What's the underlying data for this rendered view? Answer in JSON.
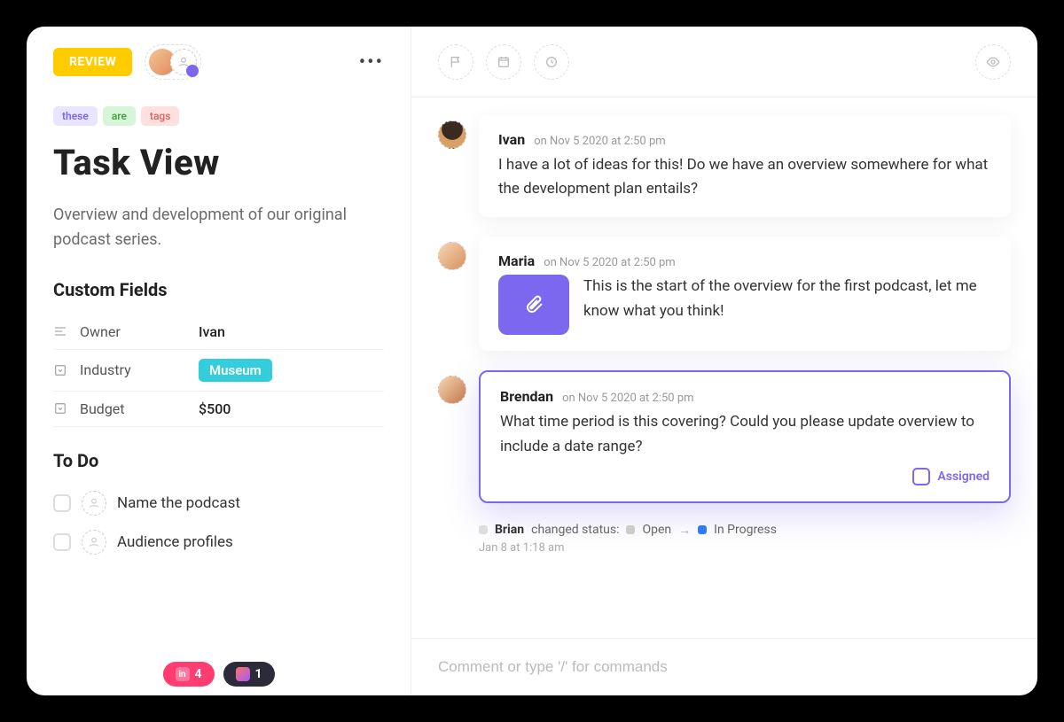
{
  "header": {
    "status_label": "REVIEW"
  },
  "task": {
    "tags": [
      "these",
      "are",
      "tags"
    ],
    "title": "Task View",
    "description": "Overview and development of our original podcast series.",
    "custom_fields_heading": "Custom Fields",
    "custom_fields": [
      {
        "label": "Owner",
        "value": "Ivan",
        "type": "text"
      },
      {
        "label": "Industry",
        "value": "Museum",
        "type": "chip"
      },
      {
        "label": "Budget",
        "value": "$500",
        "type": "text"
      }
    ],
    "todo_heading": "To Do",
    "todos": [
      {
        "text": "Name the podcast"
      },
      {
        "text": "Audience profiles"
      }
    ]
  },
  "comments": [
    {
      "author": "Ivan",
      "meta": "on Nov 5 2020 at 2:50 pm",
      "body": "I have a lot of ideas for this! Do we have an overview somewhere for what the development plan entails?"
    },
    {
      "author": "Maria",
      "meta": "on Nov 5 2020 at 2:50 pm",
      "body": "This is the start of the overview for the first podcast, let me know what you think!",
      "has_attachment": true
    },
    {
      "author": "Brendan",
      "meta": "on Nov 5 2020 at 2:50 pm",
      "body": "What time period is this covering? Could you please update overview to include a date range?",
      "assigned_label": "Assigned",
      "active": true
    }
  ],
  "activity": {
    "author": "Brian",
    "action": "changed status:",
    "from": "Open",
    "to": "In Progress",
    "timestamp": "Jan 8 at 1:18 am"
  },
  "composer": {
    "placeholder": "Comment or type '/' for commands"
  },
  "bottom_chips": [
    {
      "color": "pink",
      "count": "4"
    },
    {
      "color": "dark",
      "count": "1"
    }
  ]
}
